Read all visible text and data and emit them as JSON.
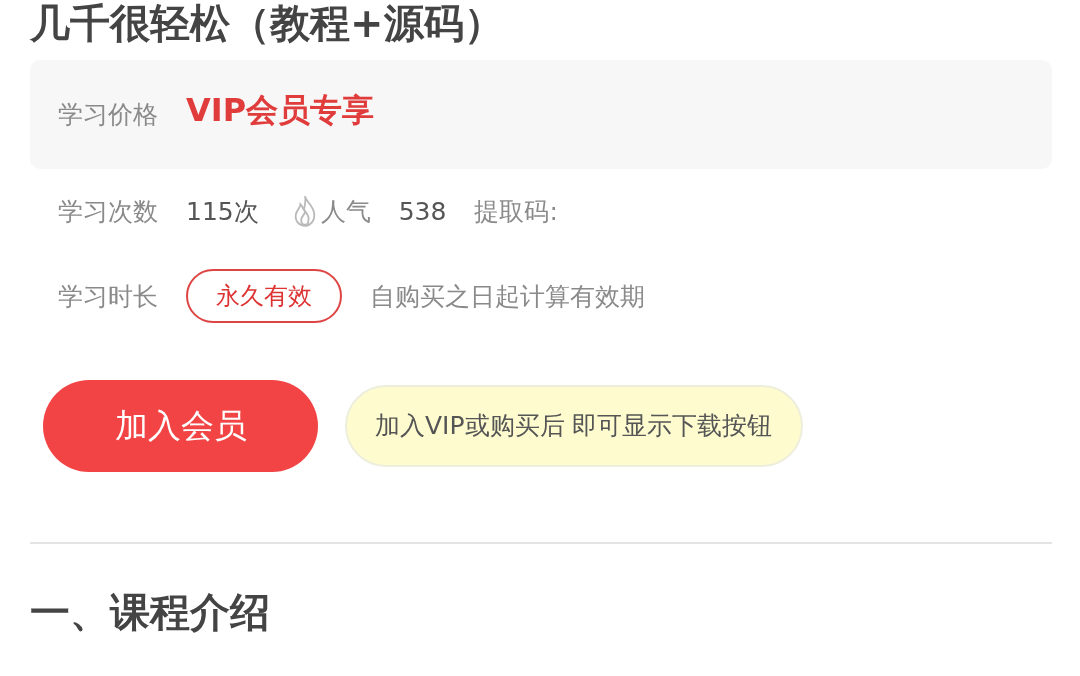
{
  "title": "几千很轻松（教程+源码）",
  "price": {
    "label": "学习价格",
    "value": "VIP会员专享"
  },
  "stats": {
    "study_label": "学习次数",
    "study_value": "115次",
    "popularity_label": "人气",
    "popularity_value": "538",
    "code_label": "提取码:"
  },
  "duration": {
    "label": "学习时长",
    "badge": "永久有效",
    "note": "自购买之日起计算有效期"
  },
  "join_button": "加入会员",
  "notice": "加入VIP或购买后 即可显示下载按钮",
  "section_heading": "一、课程介绍"
}
